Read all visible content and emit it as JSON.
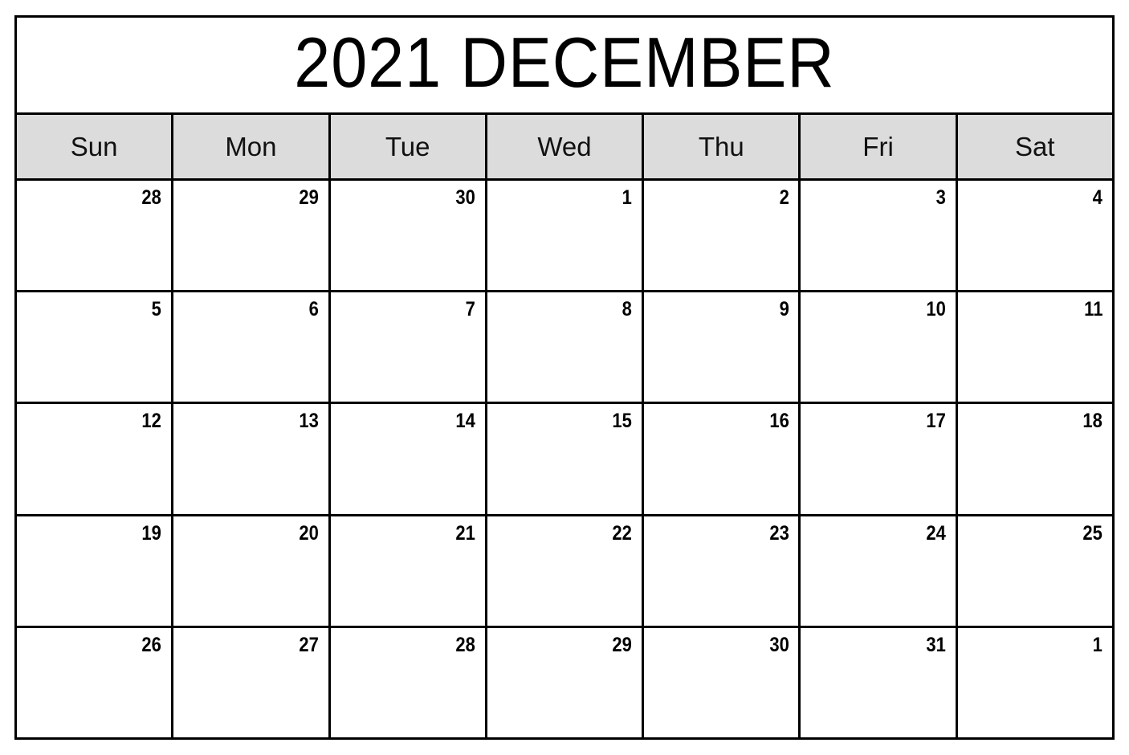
{
  "calendar": {
    "title": "2021 DECEMBER",
    "year": "2021",
    "month": "DECEMBER",
    "colors": {
      "header_background": "#DCDCDC",
      "cell_background": "#FFFFFF",
      "border": "#000000",
      "text": "#000000"
    },
    "weekday_headers": [
      {
        "label": "Sun",
        "key": "sunday"
      },
      {
        "label": "Mon",
        "key": "monday"
      },
      {
        "label": "Tue",
        "key": "tuesday"
      },
      {
        "label": "Wed",
        "key": "wednesday"
      },
      {
        "label": "Thu",
        "key": "thursday"
      },
      {
        "label": "Fri",
        "key": "friday"
      },
      {
        "label": "Sat",
        "key": "saturday"
      }
    ],
    "weeks": [
      {
        "index": 1,
        "days": [
          {
            "number": "28",
            "in_month": false
          },
          {
            "number": "29",
            "in_month": false
          },
          {
            "number": "30",
            "in_month": false
          },
          {
            "number": "1",
            "in_month": true
          },
          {
            "number": "2",
            "in_month": true
          },
          {
            "number": "3",
            "in_month": true
          },
          {
            "number": "4",
            "in_month": true
          }
        ]
      },
      {
        "index": 2,
        "days": [
          {
            "number": "5",
            "in_month": true
          },
          {
            "number": "6",
            "in_month": true
          },
          {
            "number": "7",
            "in_month": true
          },
          {
            "number": "8",
            "in_month": true
          },
          {
            "number": "9",
            "in_month": true
          },
          {
            "number": "10",
            "in_month": true
          },
          {
            "number": "11",
            "in_month": true
          }
        ]
      },
      {
        "index": 3,
        "days": [
          {
            "number": "12",
            "in_month": true
          },
          {
            "number": "13",
            "in_month": true
          },
          {
            "number": "14",
            "in_month": true
          },
          {
            "number": "15",
            "in_month": true
          },
          {
            "number": "16",
            "in_month": true
          },
          {
            "number": "17",
            "in_month": true
          },
          {
            "number": "18",
            "in_month": true
          }
        ]
      },
      {
        "index": 4,
        "days": [
          {
            "number": "19",
            "in_month": true
          },
          {
            "number": "20",
            "in_month": true
          },
          {
            "number": "21",
            "in_month": true
          },
          {
            "number": "22",
            "in_month": true
          },
          {
            "number": "23",
            "in_month": true
          },
          {
            "number": "24",
            "in_month": true
          },
          {
            "number": "25",
            "in_month": true
          }
        ]
      },
      {
        "index": 5,
        "days": [
          {
            "number": "26",
            "in_month": true
          },
          {
            "number": "27",
            "in_month": true
          },
          {
            "number": "28",
            "in_month": true
          },
          {
            "number": "29",
            "in_month": true
          },
          {
            "number": "30",
            "in_month": true
          },
          {
            "number": "31",
            "in_month": true
          },
          {
            "number": "1",
            "in_month": false
          }
        ]
      }
    ]
  }
}
